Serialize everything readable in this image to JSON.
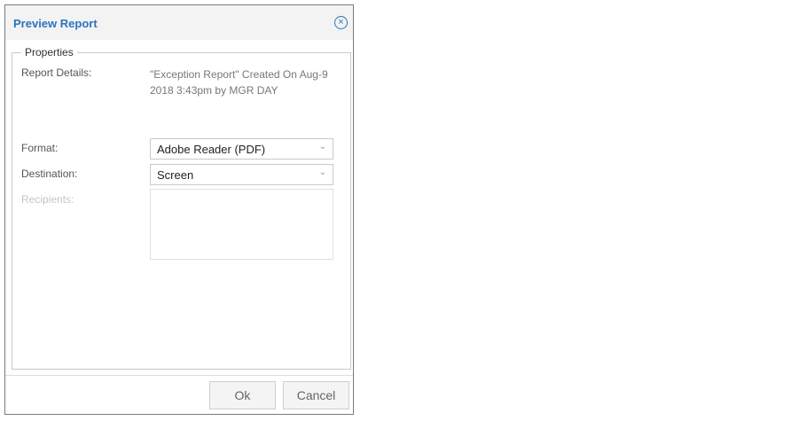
{
  "dialog": {
    "title": "Preview Report",
    "close_icon": "close-circle-icon"
  },
  "properties": {
    "legend": "Properties",
    "report_details_label": "Report Details:",
    "report_details_value": "\"Exception Report\" Created On Aug-9 2018 3:43pm by MGR DAY",
    "format_label": "Format:",
    "format_value": "Adobe Reader (PDF)",
    "destination_label": "Destination:",
    "destination_value": "Screen",
    "recipients_label": "Recipients:",
    "recipients_value": ""
  },
  "buttons": {
    "ok": "Ok",
    "cancel": "Cancel"
  },
  "colors": {
    "title": "#2a73bd",
    "disabled_text": "#c6c6c6"
  }
}
